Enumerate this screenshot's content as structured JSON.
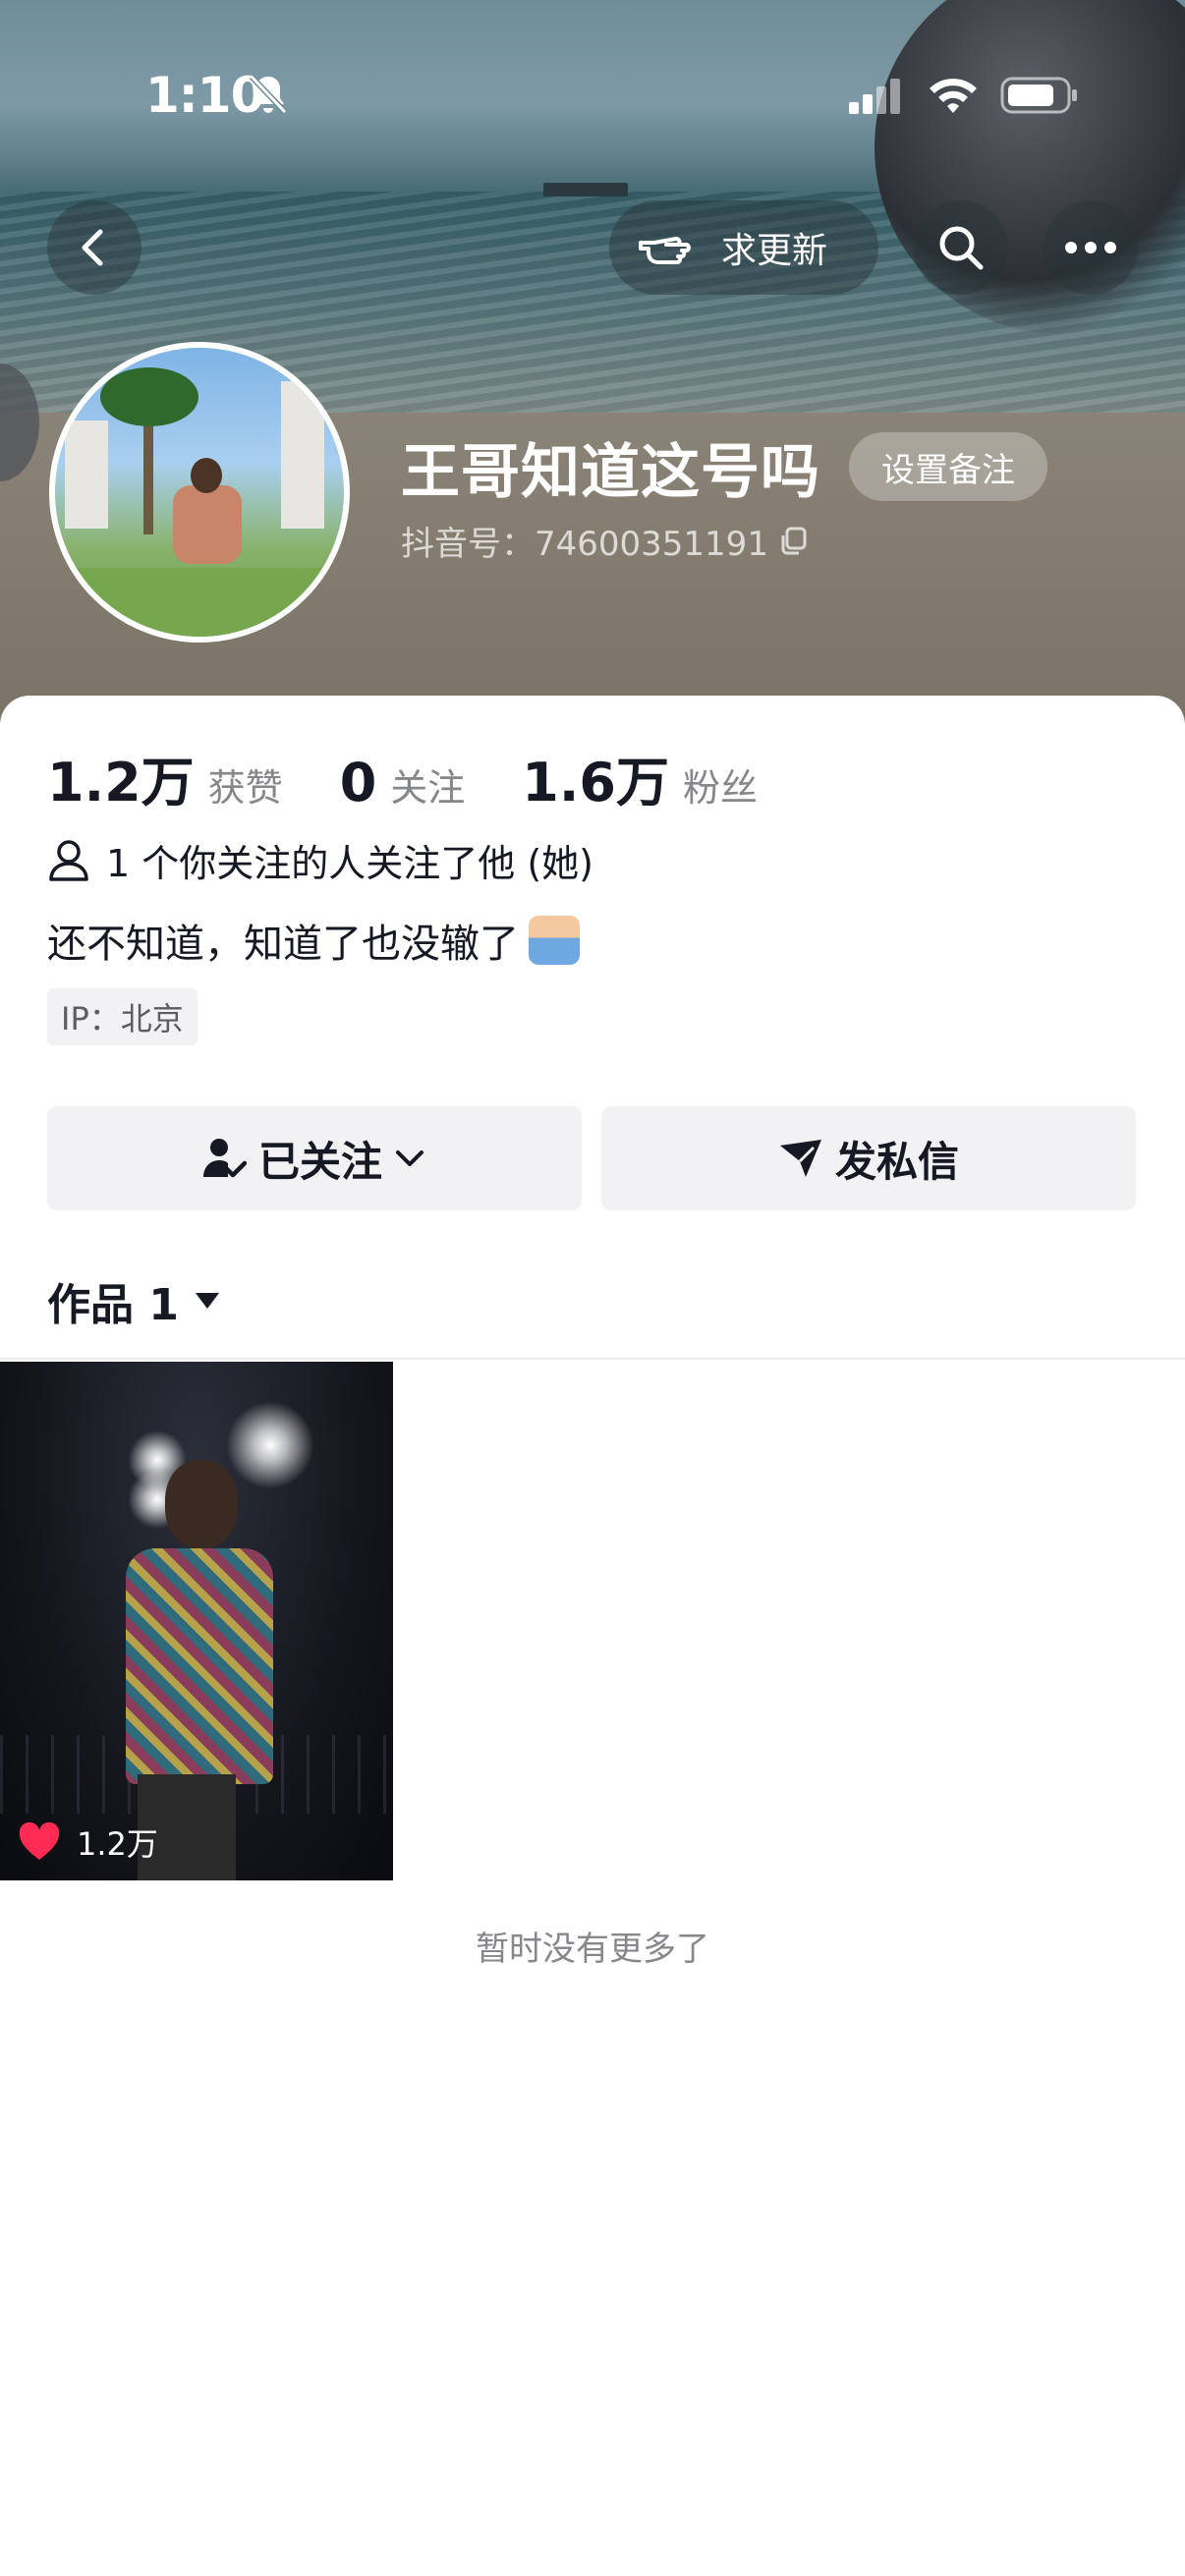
{
  "status_bar": {
    "time": "1:10"
  },
  "header": {
    "update_label": "求更新",
    "nickname": "王哥知道这号吗",
    "remark_label": "设置备注",
    "douyin_id": "抖音号：74600351191"
  },
  "stats": {
    "likes_value": "1.2万",
    "likes_label": "获赞",
    "following_value": "0",
    "following_label": "关注",
    "followers_value": "1.6万",
    "followers_label": "粉丝"
  },
  "profile": {
    "mutual_text": "1 个你关注的人关注了他 (她)",
    "bio": "还不知道，知道了也没辙了",
    "ip": "IP：北京"
  },
  "actions": {
    "follow_label": "已关注",
    "message_label": "发私信"
  },
  "works": {
    "tab_label": "作品 1",
    "items": [
      {
        "likes": "1.2万"
      }
    ],
    "end_text": "暂时没有更多了"
  },
  "colors": {
    "accent": "#fe2c55",
    "text": "#161823",
    "muted": "#86878b",
    "button_bg": "#f2f2f4"
  },
  "icons": [
    "bell-off-icon",
    "signal-icon",
    "wifi-icon",
    "battery-icon",
    "back-icon",
    "pointing-hand-icon",
    "search-icon",
    "more-icon",
    "copy-icon",
    "person-icon",
    "follow-check-icon",
    "chevron-down-icon",
    "send-icon",
    "caret-down-icon",
    "heart-icon"
  ]
}
